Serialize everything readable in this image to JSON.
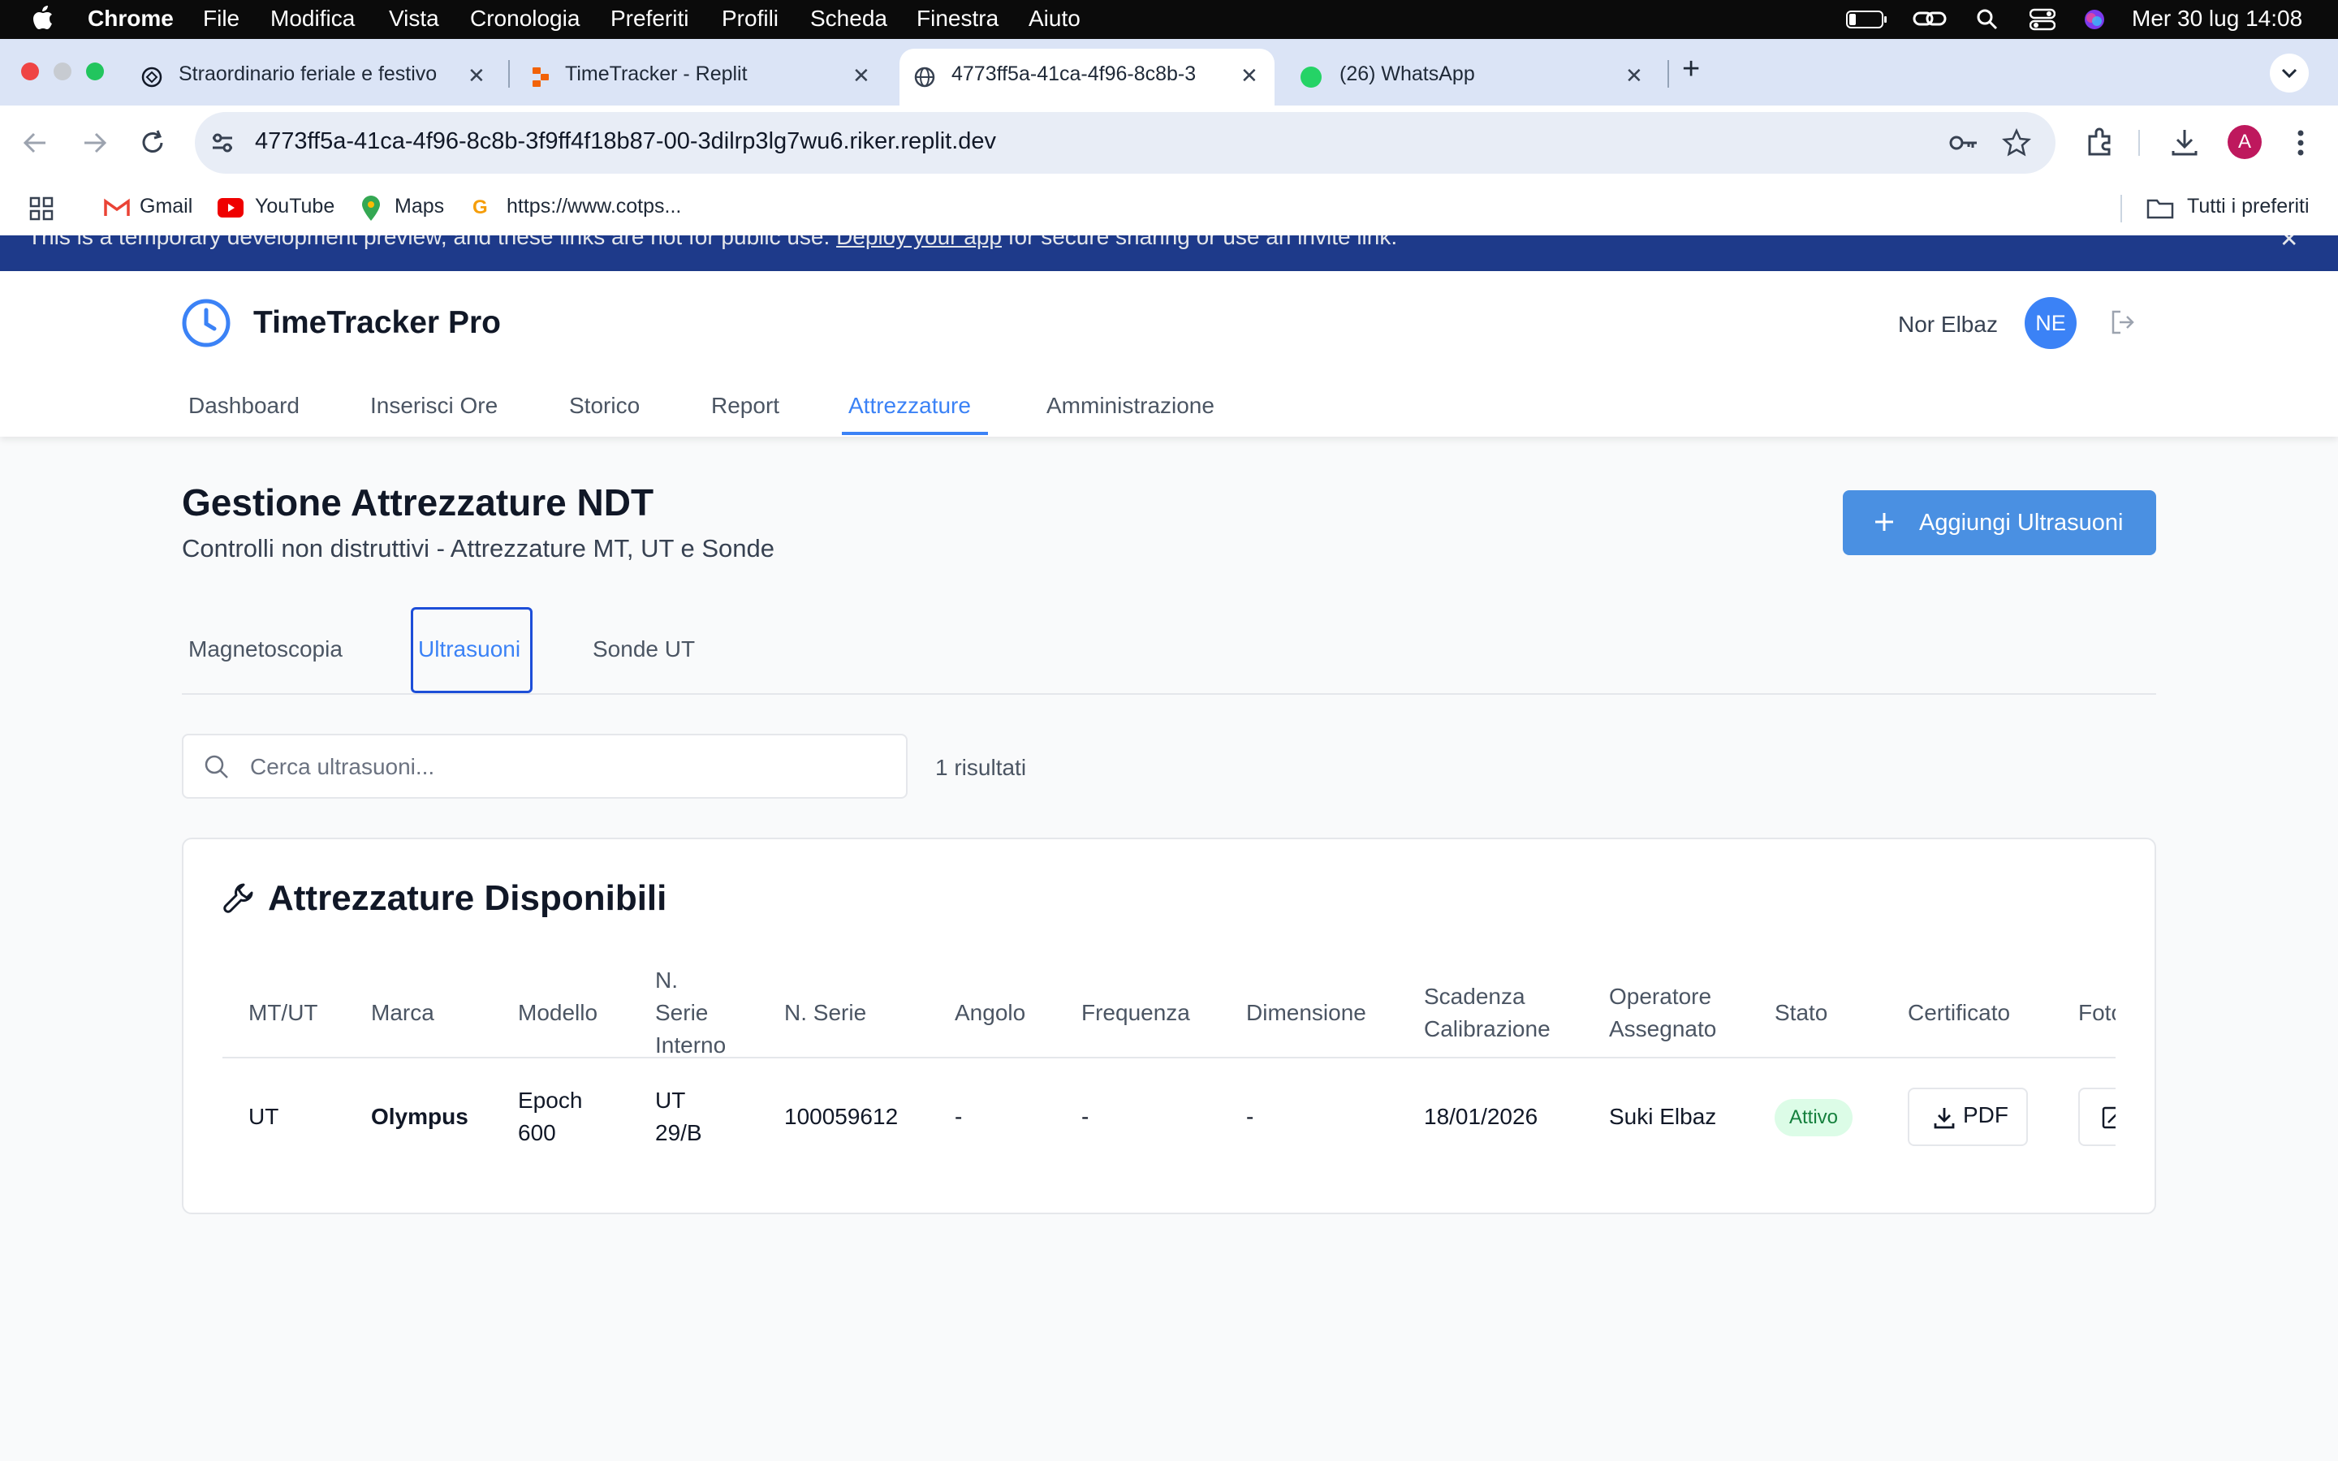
{
  "menubar": {
    "app": "Chrome",
    "items": [
      "File",
      "Modifica",
      "Vista",
      "Cronologia",
      "Preferiti",
      "Profili",
      "Scheda",
      "Finestra",
      "Aiuto"
    ],
    "clock": "Mer 30 lug  14:08"
  },
  "browser": {
    "tabs": [
      {
        "title": "Straordinario feriale e festivo",
        "icon": "openai-icon"
      },
      {
        "title": "TimeTracker - Replit",
        "icon": "replit-icon"
      },
      {
        "title": "4773ff5a-41ca-4f96-8c8b-3",
        "icon": "globe-icon"
      },
      {
        "title": "(26) WhatsApp",
        "icon": "whatsapp-icon",
        "badge": "26"
      }
    ],
    "url": "4773ff5a-41ca-4f96-8c8b-3f9ff4f18b87-00-3dilrp3lg7wu6.riker.replit.dev",
    "profile_initial": "A",
    "bookmarks": [
      "Gmail",
      "YouTube",
      "Maps",
      "https://www.cotps..."
    ],
    "all_bookmarks": "Tutti i preferiti"
  },
  "banner": {
    "text_before": "This is a temporary development preview, and these links are not for public use. ",
    "link": "Deploy your app",
    "text_after": " for secure sharing or use an invite link."
  },
  "app": {
    "name": "TimeTracker Pro",
    "user_name": "Nor Elbaz",
    "user_initials": "NE",
    "nav": [
      "Dashboard",
      "Inserisci Ore",
      "Storico",
      "Report",
      "Attrezzature",
      "Amministrazione"
    ],
    "active_nav": "Attrezzature"
  },
  "page": {
    "title": "Gestione Attrezzature NDT",
    "subtitle": "Controlli non distruttivi - Attrezzature MT, UT e Sonde",
    "add_button": "Aggiungi Ultrasuoni",
    "subtabs": [
      "Magnetoscopia",
      "Ultrasuoni",
      "Sonde UT"
    ],
    "active_subtab": "Ultrasuoni",
    "search_placeholder": "Cerca ultrasuoni...",
    "results": "1 risultati"
  },
  "table": {
    "title": "Attrezzature Disponibili",
    "headers": {
      "mtut": "MT/UT",
      "marca": "Marca",
      "modello": "Modello",
      "serie_interno_1": "N.",
      "serie_interno_2": "Serie",
      "serie_interno_3": "Interno",
      "serie": "N. Serie",
      "angolo": "Angolo",
      "frequenza": "Frequenza",
      "dimensione": "Dimensione",
      "scadenza_1": "Scadenza",
      "scadenza_2": "Calibrazione",
      "operatore_1": "Operatore",
      "operatore_2": "Assegnato",
      "stato": "Stato",
      "certificato": "Certificato",
      "foto": "Foto"
    },
    "rows": [
      {
        "mtut": "UT",
        "marca": "Olympus",
        "modello_1": "Epoch",
        "modello_2": "600",
        "serie_interno_1": "UT",
        "serie_interno_2": "29/B",
        "serie": "100059612",
        "angolo": "-",
        "frequenza": "-",
        "dimensione": "-",
        "scadenza": "18/01/2026",
        "operatore": "Suki Elbaz",
        "stato": "Attivo",
        "certificato": "PDF"
      }
    ]
  }
}
